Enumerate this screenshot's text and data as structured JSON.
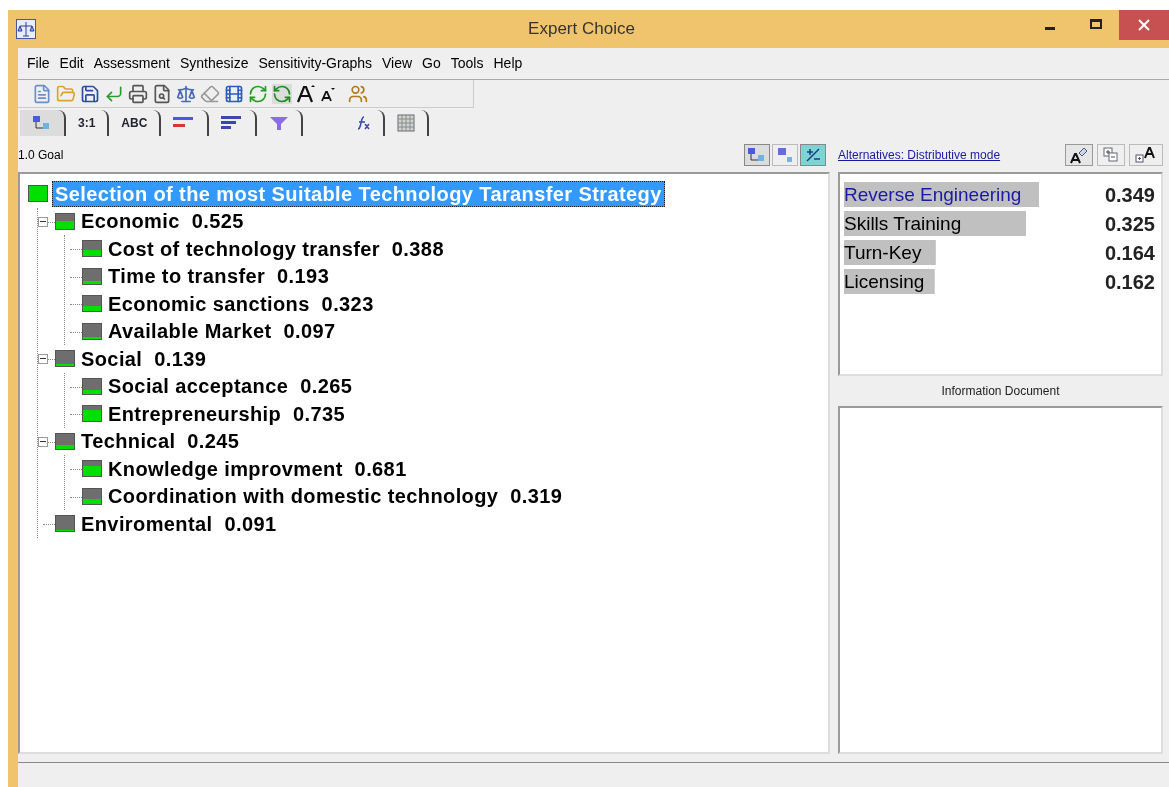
{
  "window": {
    "title": "Expert Choice"
  },
  "menu": [
    "File",
    "Edit",
    "Assessment",
    "Synthesize",
    "Sensitivity-Graphs",
    "View",
    "Go",
    "Tools",
    "Help"
  ],
  "tabs": [
    {
      "kind": "tree",
      "selected": true
    },
    {
      "kind": "text",
      "label": "3:1",
      "selected": false
    },
    {
      "kind": "text",
      "label": "ABC",
      "selected": false
    },
    {
      "kind": "bars-red",
      "selected": false
    },
    {
      "kind": "bars",
      "selected": false
    },
    {
      "kind": "funnel",
      "selected": false
    },
    {
      "kind": "formula",
      "selected": false
    },
    {
      "kind": "grid",
      "selected": false
    }
  ],
  "pane": {
    "title": "1.0 Goal"
  },
  "tree": [
    {
      "name": "Selection of the most Suitable Technology Taransfer Strategy",
      "selected": true,
      "children": [
        {
          "name": "Economic",
          "value": "0.525",
          "selected": false,
          "expanded": true,
          "children": [
            {
              "name": "Cost of technology transfer",
              "value": "0.388",
              "selected": false
            },
            {
              "name": "Time to transfer",
              "value": "0.193",
              "selected": false
            },
            {
              "name": "Economic sanctions",
              "value": "0.323",
              "selected": false
            },
            {
              "name": "Available Market",
              "value": "0.097",
              "selected": false
            }
          ]
        },
        {
          "name": "Social",
          "value": "0.139",
          "selected": false,
          "expanded": true,
          "children": [
            {
              "name": "Social acceptance",
              "value": "0.265",
              "selected": false
            },
            {
              "name": "Entrepreneurship",
              "value": "0.735",
              "selected": false
            }
          ]
        },
        {
          "name": "Technical",
          "value": "0.245",
          "selected": false,
          "expanded": true,
          "children": [
            {
              "name": "Knowledge improvment",
              "value": "0.681",
              "selected": false
            },
            {
              "name": "Coordination with domestic technology",
              "value": "0.319",
              "selected": false
            }
          ]
        },
        {
          "name": "Enviromental",
          "value": "0.091",
          "selected": false
        }
      ]
    }
  ],
  "alternatives": {
    "title": "Alternatives: Distributive mode",
    "items": [
      {
        "name": "Reverse Engineering",
        "value": "0.349",
        "selected": true
      },
      {
        "name": "Skills Training",
        "value": "0.325",
        "selected": false
      },
      {
        "name": "Turn-Key",
        "value": "0.164",
        "selected": false
      },
      {
        "name": "Licensing",
        "value": "0.162",
        "selected": false
      }
    ]
  },
  "information": {
    "title": "Information Document"
  }
}
